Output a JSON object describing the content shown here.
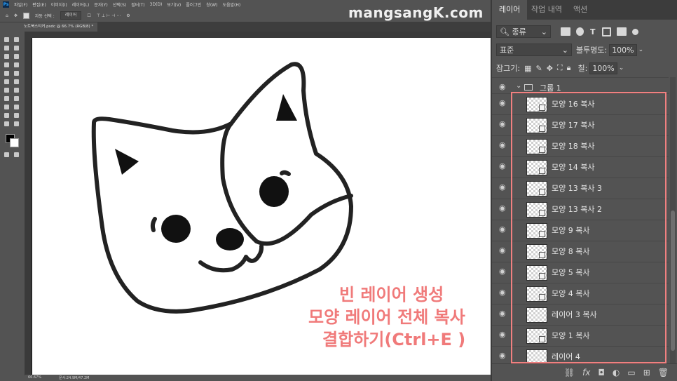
{
  "app": {
    "logo": "Ps"
  },
  "menu": [
    "파일(F)",
    "편집(E)",
    "이미지(I)",
    "레이어(L)",
    "문자(Y)",
    "선택(S)",
    "필터(T)",
    "3D(D)",
    "보기(V)",
    "플러그인",
    "창(W)",
    "도움말(H)"
  ],
  "options_bar": {
    "auto_select_label": "자동 선택 :",
    "auto_select_value": "레이어"
  },
  "document_tab": {
    "title": "노트북스티커.psdc @ 66.7% (RGB/8) *"
  },
  "status": {
    "zoom": "66.67%",
    "doc_info": "문서:24.9M/47.2M"
  },
  "watermark": "mangsangK.com",
  "overlay_text": [
    "빈 레이어 생성",
    "모양 레이어 전체 복사",
    "결합하기(Ctrl+E )"
  ],
  "panel": {
    "tabs": [
      "레이어",
      "작업 내역",
      "액션"
    ],
    "filter": {
      "label": "종류"
    },
    "blend_mode": "표준",
    "opacity_label": "불투명도:",
    "opacity_value": "100%",
    "lock_label": "잠그기:",
    "fill_label": "칠:",
    "fill_value": "100%",
    "group_name": "그룹 1",
    "layers": [
      "모양 16 복사",
      "모양 17 복사",
      "모양 18 복사",
      "모양 14 복사",
      "모양 13 복사 3",
      "모양 13 복사 2",
      "모양 9 복사",
      "모양 8 복사",
      "모양 5 복사",
      "모양 4 복사",
      "레이어 3 복사",
      "모양 1 복사",
      "레이어 4"
    ]
  },
  "colors": {
    "highlight": "#f08080",
    "overlay_text": "#f07a7a"
  }
}
